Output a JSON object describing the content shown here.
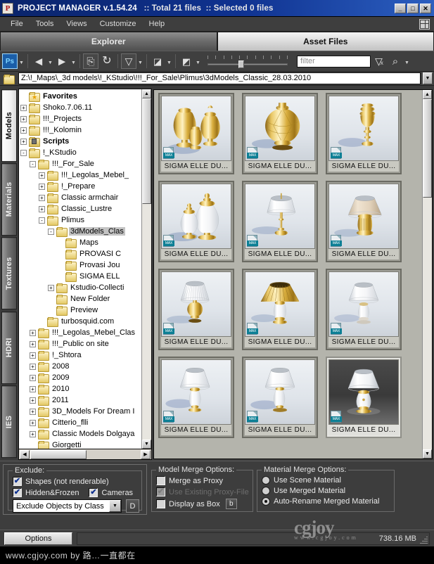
{
  "window": {
    "app_icon": "P",
    "title": "PROJECT MANAGER v.1.54.24",
    "total_files": ":: Total 21 files",
    "selected_files": ":: Selected 0 files",
    "minimize": "_",
    "maximize": "□",
    "close": "✕"
  },
  "menu": {
    "items": [
      {
        "label": "File"
      },
      {
        "label": "Tools"
      },
      {
        "label": "Views"
      },
      {
        "label": "Customize"
      },
      {
        "label": "Help"
      }
    ],
    "layout_icon": "panel-layout-icon"
  },
  "main_tabs": [
    {
      "label": "Explorer",
      "active": false
    },
    {
      "label": "Asset Files",
      "active": true
    }
  ],
  "toolbar": {
    "photoshop_label": "Ps",
    "back_icon": "←",
    "forward_icon": "→",
    "refresh_folder_icon": "⮌",
    "reload_icon": "↻",
    "filter_funnel_icon": "▽",
    "render_preview_icon": "◢",
    "render_to_file_icon": "◣",
    "zoom_slider_value": 40,
    "filter_placeholder": "filter",
    "clear_filter_icon": "funnel-x-icon",
    "search_icon": "⌕"
  },
  "path_bar": {
    "value": "Z:\\!_Maps\\_3d models\\!_KStudio\\!!!_For_Sale\\Plimus\\3dModels_Classic_28.03.2010",
    "dropdown_icon": "▼"
  },
  "vertical_tabs": [
    {
      "label": "Models",
      "active": true
    },
    {
      "label": "Materials",
      "active": false
    },
    {
      "label": "Textures",
      "active": false
    },
    {
      "label": "HDRI",
      "active": false
    },
    {
      "label": "IES",
      "active": false
    }
  ],
  "tree": {
    "nodes": [
      {
        "label": "Favorites",
        "indent": 0,
        "expander": "",
        "bold": true,
        "selected": false,
        "icon": "favorites-folder-icon"
      },
      {
        "label": "Shoko.7.06.11",
        "indent": 0,
        "expander": "+",
        "bold": false,
        "selected": false,
        "icon": "folder-icon"
      },
      {
        "label": "!!!_Projects",
        "indent": 0,
        "expander": "+",
        "bold": false,
        "selected": false,
        "icon": "folder-icon"
      },
      {
        "label": "!!!_Kolomin",
        "indent": 0,
        "expander": "+",
        "bold": false,
        "selected": false,
        "icon": "folder-icon"
      },
      {
        "label": "Scripts",
        "indent": 0,
        "expander": "+",
        "bold": true,
        "selected": false,
        "icon": "scripts-folder-icon"
      },
      {
        "label": "!_KStudio",
        "indent": 0,
        "expander": "-",
        "bold": false,
        "selected": false,
        "icon": "folder-icon"
      },
      {
        "label": "!!!_For_Sale",
        "indent": 1,
        "expander": "-",
        "bold": false,
        "selected": false,
        "icon": "folder-icon"
      },
      {
        "label": "!!!_Legolas_Mebel_",
        "indent": 2,
        "expander": "+",
        "bold": false,
        "selected": false,
        "icon": "folder-icon"
      },
      {
        "label": "!_Prepare",
        "indent": 2,
        "expander": "+",
        "bold": false,
        "selected": false,
        "icon": "folder-icon"
      },
      {
        "label": "Classic armchair",
        "indent": 2,
        "expander": "+",
        "bold": false,
        "selected": false,
        "icon": "folder-icon"
      },
      {
        "label": "Classic_Lustre",
        "indent": 2,
        "expander": "+",
        "bold": false,
        "selected": false,
        "icon": "folder-icon"
      },
      {
        "label": "Plimus",
        "indent": 2,
        "expander": "-",
        "bold": false,
        "selected": false,
        "icon": "folder-icon"
      },
      {
        "label": "3dModels_Clas",
        "indent": 3,
        "expander": "-",
        "bold": false,
        "selected": true,
        "icon": "folder-icon"
      },
      {
        "label": "Maps",
        "indent": 4,
        "expander": "",
        "bold": false,
        "selected": false,
        "icon": "folder-icon"
      },
      {
        "label": "PROVASI C",
        "indent": 4,
        "expander": "",
        "bold": false,
        "selected": false,
        "icon": "folder-icon"
      },
      {
        "label": "Provasi Jou",
        "indent": 4,
        "expander": "",
        "bold": false,
        "selected": false,
        "icon": "folder-icon"
      },
      {
        "label": "SIGMA ELL",
        "indent": 4,
        "expander": "",
        "bold": false,
        "selected": false,
        "icon": "folder-icon"
      },
      {
        "label": "Kstudio-Collecti",
        "indent": 3,
        "expander": "+",
        "bold": false,
        "selected": false,
        "icon": "folder-icon"
      },
      {
        "label": "New Folder",
        "indent": 3,
        "expander": "",
        "bold": false,
        "selected": false,
        "icon": "folder-icon"
      },
      {
        "label": "Preview",
        "indent": 3,
        "expander": "",
        "bold": false,
        "selected": false,
        "icon": "folder-icon"
      },
      {
        "label": "turbosquid.com",
        "indent": 2,
        "expander": "",
        "bold": false,
        "selected": false,
        "icon": "folder-icon"
      },
      {
        "label": "!!!_Legolas_Mebel_Clas",
        "indent": 1,
        "expander": "+",
        "bold": false,
        "selected": false,
        "icon": "folder-icon"
      },
      {
        "label": "!!!_Public on site",
        "indent": 1,
        "expander": "+",
        "bold": false,
        "selected": false,
        "icon": "folder-icon"
      },
      {
        "label": "!_Shtora",
        "indent": 1,
        "expander": "+",
        "bold": false,
        "selected": false,
        "icon": "folder-icon"
      },
      {
        "label": "2008",
        "indent": 1,
        "expander": "+",
        "bold": false,
        "selected": false,
        "icon": "folder-icon"
      },
      {
        "label": "2009",
        "indent": 1,
        "expander": "+",
        "bold": false,
        "selected": false,
        "icon": "folder-icon"
      },
      {
        "label": "2010",
        "indent": 1,
        "expander": "+",
        "bold": false,
        "selected": false,
        "icon": "folder-icon"
      },
      {
        "label": "2011",
        "indent": 1,
        "expander": "+",
        "bold": false,
        "selected": false,
        "icon": "folder-icon"
      },
      {
        "label": "3D_Models For Dream I",
        "indent": 1,
        "expander": "+",
        "bold": false,
        "selected": false,
        "icon": "folder-icon"
      },
      {
        "label": "Citterio_flli",
        "indent": 1,
        "expander": "+",
        "bold": false,
        "selected": false,
        "icon": "folder-icon"
      },
      {
        "label": "Classic Models Dolgaya",
        "indent": 1,
        "expander": "+",
        "bold": false,
        "selected": false,
        "icon": "folder-icon"
      },
      {
        "label": "Giorgetti",
        "indent": 1,
        "expander": "",
        "bold": false,
        "selected": false,
        "icon": "folder-icon"
      }
    ],
    "scroll_left_icon": "◀",
    "scroll_right_icon": "▶",
    "scroll_up_icon": "▲",
    "scroll_down_icon": "▼"
  },
  "grid": {
    "badge": "MAX",
    "items": [
      {
        "label": "SIGMA ELLE DU...",
        "art": "urn-trio-gold",
        "highlight": false
      },
      {
        "label": "SIGMA ELLE DU...",
        "art": "sphere-gold",
        "highlight": false
      },
      {
        "label": "SIGMA ELLE DU...",
        "art": "goblet-gold",
        "highlight": false
      },
      {
        "label": "SIGMA ELLE DU...",
        "art": "urn-pair-white",
        "highlight": false
      },
      {
        "label": "SIGMA ELLE DU...",
        "art": "lamp-tall-white",
        "highlight": false
      },
      {
        "label": "SIGMA ELLE DU...",
        "art": "lamp-beige",
        "highlight": false
      },
      {
        "label": "SIGMA ELLE DU...",
        "art": "lamp-pleat",
        "highlight": false
      },
      {
        "label": "SIGMA ELLE DU...",
        "art": "lamp-gold-shade",
        "highlight": false
      },
      {
        "label": "SIGMA ELLE DU...",
        "art": "lamp-white-urn",
        "highlight": false
      },
      {
        "label": "SIGMA ELLE DU...",
        "art": "lamp-white-a",
        "highlight": false
      },
      {
        "label": "SIGMA ELLE DU...",
        "art": "lamp-white-b",
        "highlight": false
      },
      {
        "label": "SIGMA ELLE DU...",
        "art": "lamp-white-dark",
        "highlight": true
      }
    ]
  },
  "options": {
    "exclude": {
      "legend": "Exclude:",
      "shapes": {
        "label": "Shapes (not renderable)",
        "checked": true
      },
      "hidden_frozen": {
        "label": "Hidden&Frozen",
        "checked": true
      },
      "cameras": {
        "label": "Cameras",
        "checked": true
      },
      "class_combo_value": "Exclude Objects by Class",
      "class_combo_button": "D"
    },
    "model_merge": {
      "legend": "Model Merge Options:",
      "merge_as_proxy": {
        "label": "Merge as Proxy",
        "checked": false,
        "disabled": false
      },
      "use_existing_proxy": {
        "label": "Use Existing Proxy-File",
        "checked": true,
        "disabled": true
      },
      "display_as_box": {
        "label": "Display as Box",
        "checked": false,
        "disabled": false
      },
      "browse_button": "b"
    },
    "material_merge": {
      "legend": "Material Merge Options:",
      "choices": [
        {
          "label": "Use Scene Material",
          "selected": false
        },
        {
          "label": "Use Merged Material",
          "selected": false
        },
        {
          "label": "Auto-Rename Merged Material",
          "selected": true
        }
      ]
    }
  },
  "statusbar": {
    "options_button": "Options",
    "memory": "738.16 MB"
  },
  "watermark": {
    "big": "cgjoy",
    "small": "www.cgjoy.com"
  },
  "footer": {
    "text": "www.cgjoy.com by 路…一直都在"
  },
  "colors": {
    "titlebar_start": "#0a246a",
    "titlebar_end": "#2c5fc0",
    "chrome": "#3c3c3c",
    "grid_bg": "#b4b4ac",
    "accent_badge": "#0c7f95"
  }
}
